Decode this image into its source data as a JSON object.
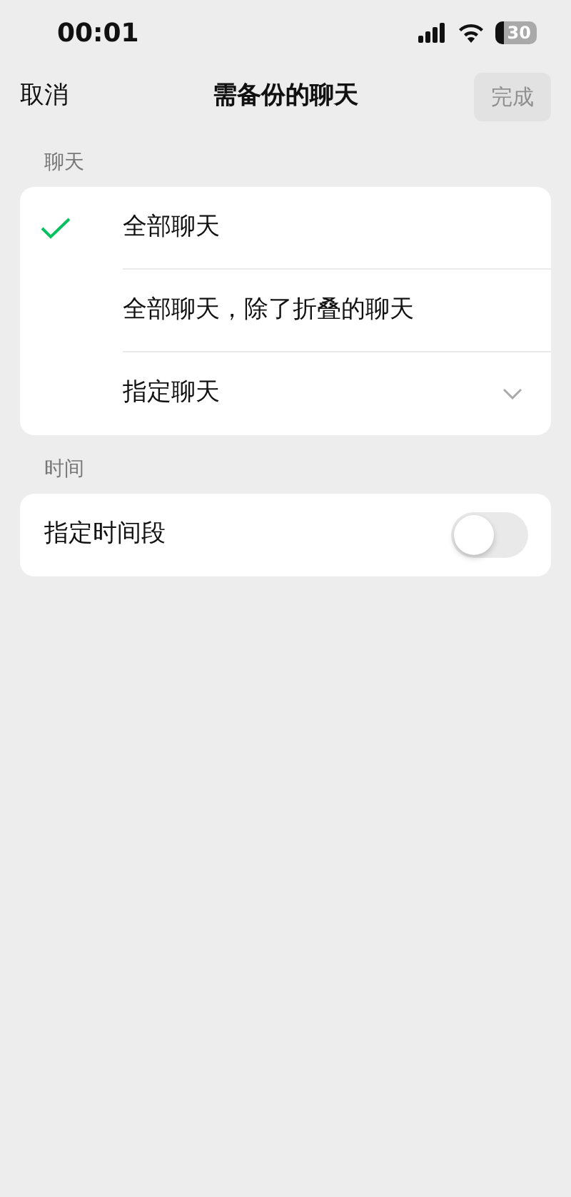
{
  "status_bar": {
    "time": "00:01",
    "battery": "30"
  },
  "nav": {
    "cancel": "取消",
    "title": "需备份的聊天",
    "done": {
      "label": "完成",
      "disabled": true
    }
  },
  "sections": [
    {
      "header": "聊天",
      "rows": [
        {
          "kind": "option",
          "label": "全部聊天",
          "selected": true
        },
        {
          "kind": "option",
          "label": "全部聊天，除了折叠的聊天",
          "selected": false
        },
        {
          "kind": "dropdown",
          "label": "指定聊天",
          "selected": false,
          "expanded": false
        }
      ]
    },
    {
      "header": "时间",
      "rows": [
        {
          "kind": "toggle",
          "label": "指定时间段",
          "on": false
        }
      ]
    }
  ]
}
